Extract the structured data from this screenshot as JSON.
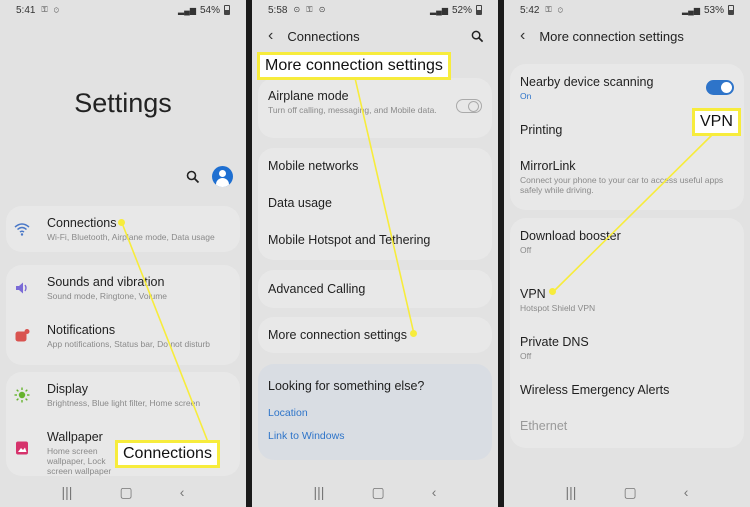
{
  "panel1": {
    "status": {
      "time": "5:41",
      "icons": "⚿ ⊙",
      "battery": "54%"
    },
    "title": "Settings",
    "items": [
      {
        "title": "Connections",
        "sub": "Wi-Fi, Bluetooth, Airplane mode, Data usage",
        "icon": "wifi-icon",
        "color": "#4a78c7"
      },
      {
        "title": "Sounds and vibration",
        "sub": "Sound mode, Ringtone, Volume",
        "icon": "speaker-icon",
        "color": "#7a6ad6"
      },
      {
        "title": "Notifications",
        "sub": "App notifications, Status bar, Do not disturb",
        "icon": "notification-icon",
        "color": "#d9534f"
      },
      {
        "title": "Display",
        "sub": "Brightness, Blue light filter, Home screen",
        "icon": "sun-icon",
        "color": "#66b32e"
      },
      {
        "title": "Wallpaper",
        "sub": "Home screen wallpaper, Lock screen wallpaper",
        "icon": "picture-icon",
        "color": "#d6336c"
      }
    ],
    "callout": "Connections"
  },
  "panel2": {
    "status": {
      "time": "5:58",
      "icons": "⊙ ⚿ ⊙",
      "battery": "52%"
    },
    "title": "Connections",
    "airplane": {
      "title": "Airplane mode",
      "sub": "Turn off calling, messaging, and Mobile data."
    },
    "items": [
      "Mobile networks",
      "Data usage",
      "Mobile Hotspot and Tethering",
      "Advanced Calling",
      "More connection settings"
    ],
    "looking": {
      "title": "Looking for something else?",
      "links": [
        "Location",
        "Link to Windows"
      ]
    },
    "callout": "More connection settings"
  },
  "panel3": {
    "status": {
      "time": "5:42",
      "icons": "⚿ ⊙",
      "battery": "53%"
    },
    "title": "More connection settings",
    "items": [
      {
        "title": "Nearby device scanning",
        "sub": "On"
      },
      {
        "title": "Printing",
        "sub": ""
      },
      {
        "title": "MirrorLink",
        "sub": "Connect your phone to your car to access useful apps safely while driving."
      },
      {
        "title": "Download booster",
        "sub": "Off"
      },
      {
        "title": "VPN",
        "sub": "Hotspot Shield VPN"
      },
      {
        "title": "Private DNS",
        "sub": "Off"
      },
      {
        "title": "Wireless Emergency Alerts",
        "sub": ""
      },
      {
        "title": "Ethernet",
        "sub": ""
      }
    ],
    "callout": "VPN"
  },
  "colors": {
    "callout_border": "#f7ec3c",
    "accent": "#2e74c9",
    "avatar": "#1e6fd1"
  }
}
